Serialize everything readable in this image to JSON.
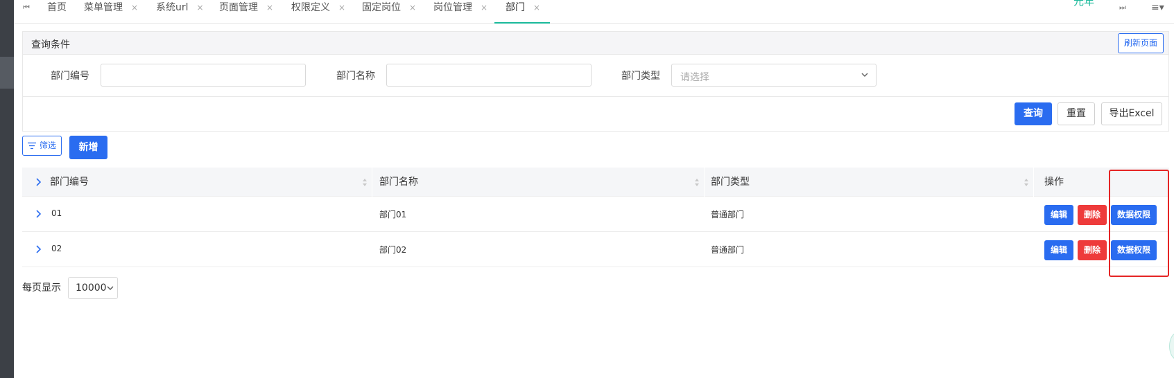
{
  "tabs": {
    "nav_first": "⏮",
    "nav_last": "⏭",
    "menu_icon": "≡▾",
    "items": [
      {
        "label": "首页"
      },
      {
        "label": "菜单管理",
        "close": "×"
      },
      {
        "label": "系统url",
        "close": "×"
      },
      {
        "label": "页面管理",
        "close": "×"
      },
      {
        "label": "权限定义",
        "close": "×"
      },
      {
        "label": "固定岗位",
        "close": "×"
      },
      {
        "label": "岗位管理",
        "close": "×"
      },
      {
        "label": "部门",
        "close": "×",
        "active": true
      }
    ],
    "partial_text": "元年"
  },
  "query": {
    "title": "查询条件",
    "refresh_label": "刷新页面",
    "fields": [
      {
        "label": "部门编号",
        "value": ""
      },
      {
        "label": "部门名称",
        "value": ""
      },
      {
        "label": "部门类型",
        "placeholder": "请选择"
      }
    ],
    "search_label": "查询",
    "reset_label": "重置",
    "export_label": "导出Excel"
  },
  "toolbar": {
    "filter_label": "筛选",
    "add_label": "新增"
  },
  "table": {
    "columns": [
      "部门编号",
      "部门名称",
      "部门类型",
      "操作"
    ],
    "rows": [
      {
        "code": "01",
        "name": "部门01",
        "type": "普通部门"
      },
      {
        "code": "02",
        "name": "部门02",
        "type": "普通部门"
      }
    ],
    "actions": {
      "edit": "编辑",
      "delete": "删除",
      "data_perm": "数据权限"
    }
  },
  "pager": {
    "label": "每页显示",
    "page_size": "10000"
  },
  "colors": {
    "primary": "#2a6cf0",
    "danger": "#ee3b3b",
    "accent": "#19b99a",
    "highlight": "#e52525"
  }
}
